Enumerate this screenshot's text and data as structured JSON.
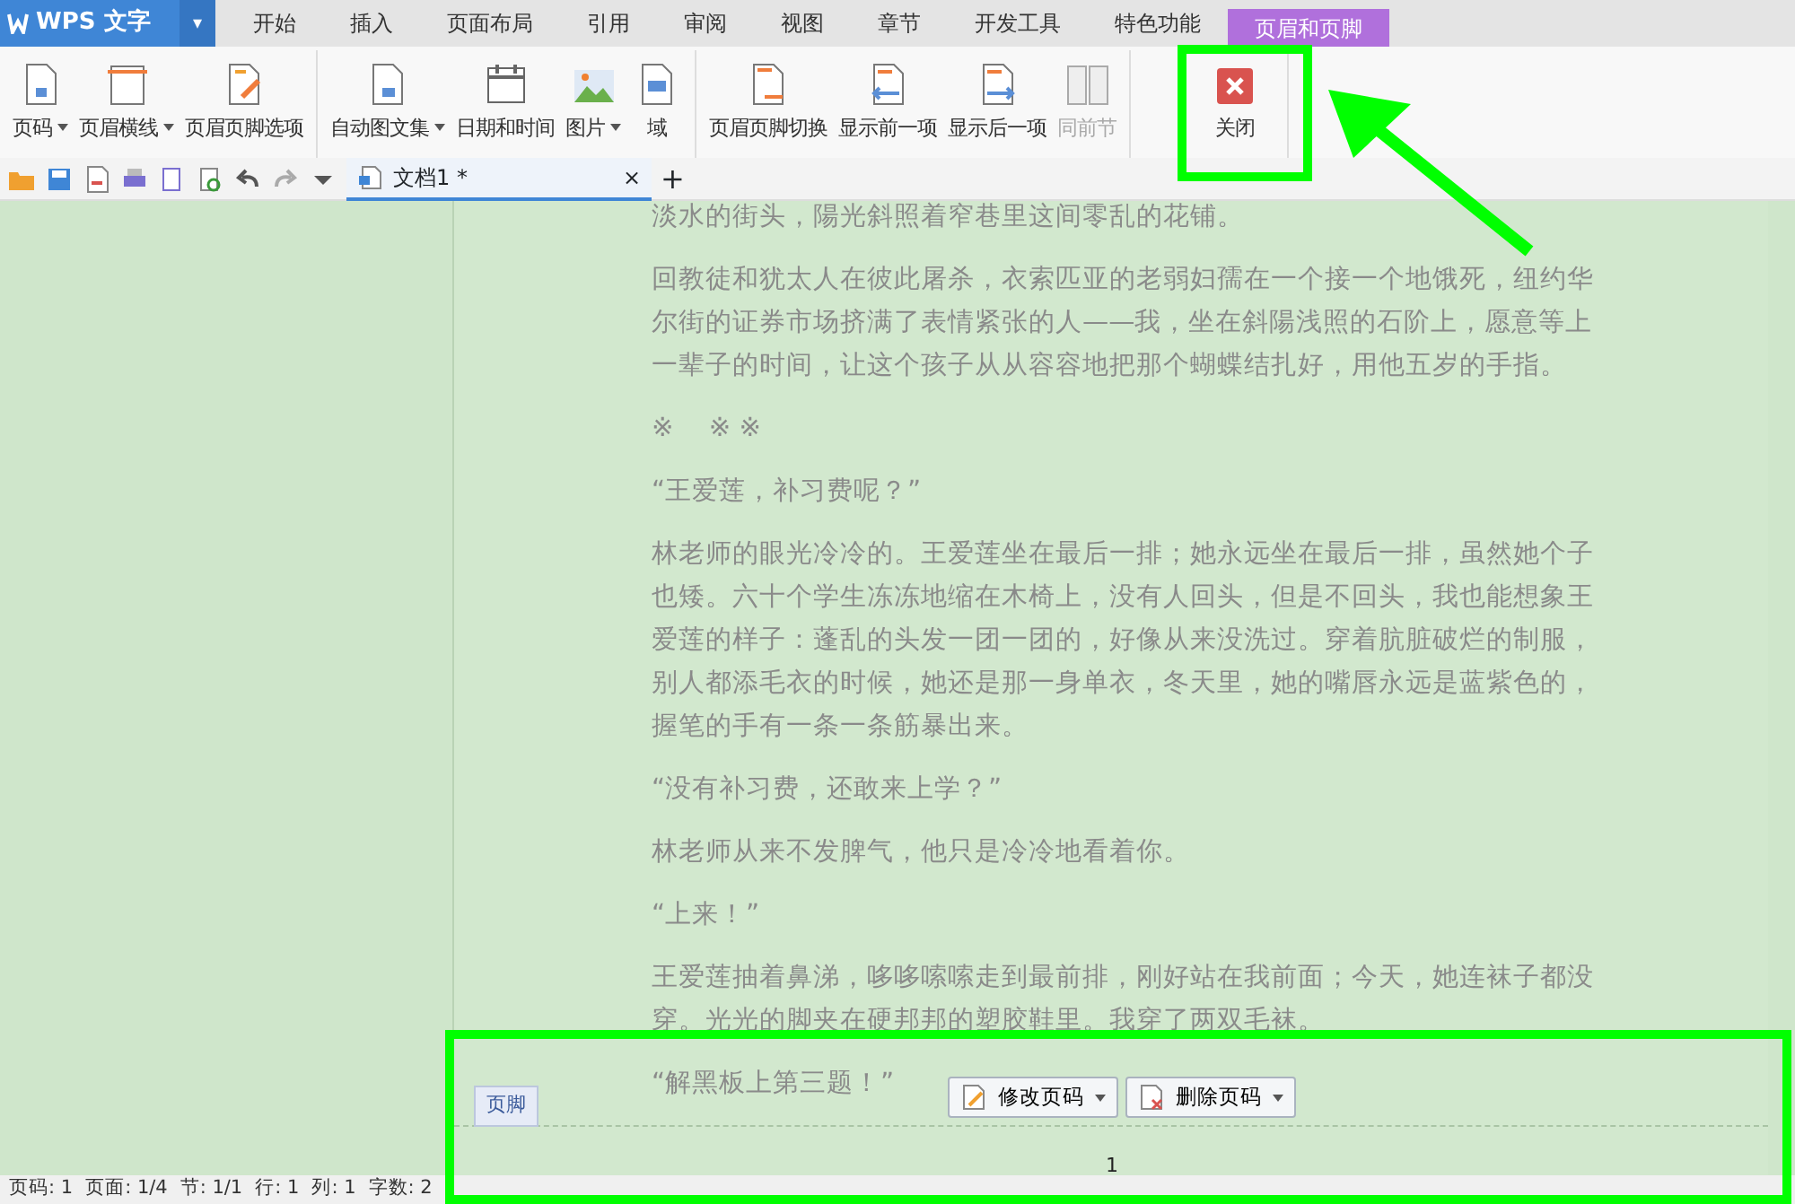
{
  "app_menu": {
    "label": "WPS 文字",
    "caret": "▾"
  },
  "tabs": [
    {
      "label": "开始",
      "selected": false
    },
    {
      "label": "插入",
      "selected": false
    },
    {
      "label": "页面布局",
      "selected": false
    },
    {
      "label": "引用",
      "selected": false
    },
    {
      "label": "审阅",
      "selected": false
    },
    {
      "label": "视图",
      "selected": false
    },
    {
      "label": "章节",
      "selected": false
    },
    {
      "label": "开发工具",
      "selected": false
    },
    {
      "label": "特色功能",
      "selected": false
    },
    {
      "label": "页眉和页脚",
      "selected": true
    }
  ],
  "ribbon": [
    [
      {
        "label": "页码",
        "dropdown": true,
        "disabled": false
      },
      {
        "label": "页眉横线",
        "dropdown": true,
        "disabled": false
      },
      {
        "label": "页眉页脚选项",
        "dropdown": false,
        "disabled": false
      }
    ],
    [
      {
        "label": "自动图文集",
        "dropdown": true,
        "disabled": false
      },
      {
        "label": "日期和时间",
        "dropdown": false,
        "disabled": false
      },
      {
        "label": "图片",
        "dropdown": true,
        "disabled": false
      },
      {
        "label": "域",
        "dropdown": false,
        "disabled": false
      }
    ],
    [
      {
        "label": "页眉页脚切换",
        "dropdown": false,
        "disabled": false
      },
      {
        "label": "显示前一项",
        "dropdown": false,
        "disabled": false
      },
      {
        "label": "显示后一项",
        "dropdown": false,
        "disabled": false
      },
      {
        "label": "同前节",
        "dropdown": false,
        "disabled": true
      }
    ],
    [
      {
        "label": "关闭",
        "dropdown": false,
        "disabled": false
      }
    ]
  ],
  "document_tab": {
    "title": "文档1 *",
    "close": "×",
    "new": "+"
  },
  "paragraphs": [
    "淡水的街头，陽光斜照着窄巷里这间零乱的花铺。",
    "回教徒和犹太人在彼此屠杀，衣索匹亚的老弱妇孺在一个接一个地饿死，纽约华尔街的证券市场挤满了表情紧张的人——我，坐在斜陽浅照的石阶上，愿意等上一辈子的时间，让这个孩子从从容容地把那个蝴蝶结扎好，用他五岁的手指。",
    "※　 ※ ※",
    "“王爱莲，补习费呢？”",
    "林老师的眼光冷冷的。王爱莲坐在最后一排；她永远坐在最后一排，虽然她个子也矮。六十个学生冻冻地缩在木椅上，没有人回头，但是不回头，我也能想象王爱莲的样子：蓬乱的头发一团一团的，好像从来没洗过。穿着肮脏破烂的制服，别人都添毛衣的时候，她还是那一身单衣，冬天里，她的嘴唇永远是蓝紫色的，握笔的手有一条一条筋暴出来。",
    "“没有补习费，还敢来上学？”",
    "林老师从来不发脾气，他只是冷冷地看着你。",
    "“上来！”",
    "王爱莲抽着鼻涕，哆哆嗦嗦走到最前排，刚好站在我前面；今天，她连袜子都没穿。光光的脚夹在硬邦邦的塑胶鞋里。我穿了两双毛袜。",
    "“解黑板上第三题！”"
  ],
  "footer": {
    "label": "页脚",
    "buttons": [
      {
        "label": "修改页码",
        "kind": "edit"
      },
      {
        "label": "删除页码",
        "kind": "delete"
      }
    ],
    "page_number": "1"
  },
  "status_bar": [
    "页码: 1",
    "页面: 1/4",
    "节: 1/1",
    "行: 1",
    "列: 1",
    "字数: 2"
  ]
}
